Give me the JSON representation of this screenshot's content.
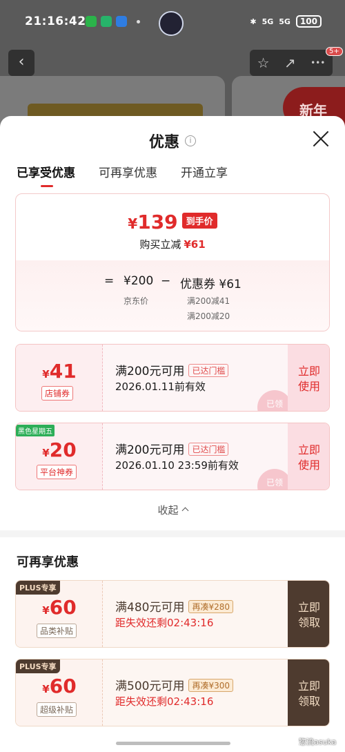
{
  "status_bar": {
    "time": "21:16:42",
    "battery": "100",
    "net1": "5G",
    "net2": "5G"
  },
  "background": {
    "back_glyph": "‹",
    "star_glyph": "☆",
    "share_glyph": "↗",
    "more_glyph": "•••",
    "badge": "5+",
    "newyear": "新年"
  },
  "sheet": {
    "title": "优惠",
    "info_glyph": "i",
    "tabs": [
      {
        "label": "已享受优惠",
        "active": true
      },
      {
        "label": "可再享优惠",
        "active": false
      },
      {
        "label": "开通立享",
        "active": false
      }
    ]
  },
  "summary": {
    "currency": "¥",
    "final_price": "139",
    "price_tag": "到手价",
    "reduce_label": "购买立减",
    "reduce_value": "¥61",
    "eq": "=",
    "base_price": "¥200",
    "base_label": "京东价",
    "minus": "−",
    "coupon_total": "优惠券 ¥61",
    "coupon_detail_1": "满200减41",
    "coupon_detail_2": "满200减20"
  },
  "coupons": [
    {
      "currency": "¥",
      "amount": "41",
      "type": "店铺券",
      "flag": "",
      "condition": "满200元可用",
      "badge": "已达门槛",
      "valid": "2026.01.11前有效",
      "stamp": "已领",
      "action_line1": "立即",
      "action_line2": "使用"
    },
    {
      "currency": "¥",
      "amount": "20",
      "type": "平台神券",
      "flag": "黑色星期五",
      "condition": "满200元可用",
      "badge": "已达门槛",
      "valid": "2026.01.10 23:59前有效",
      "stamp": "已领",
      "action_line1": "立即",
      "action_line2": "使用"
    }
  ],
  "collapse_label": "收起",
  "more_section": {
    "title": "可再享优惠",
    "items": [
      {
        "flag": "PLUS专享",
        "currency": "¥",
        "amount": "60",
        "type": "品类补贴",
        "condition": "满480元可用",
        "badge": "再凑¥280",
        "expire": "距失效还剩02:43:16",
        "action_line1": "立即",
        "action_line2": "领取"
      },
      {
        "flag": "PLUS专享",
        "currency": "¥",
        "amount": "60",
        "type": "超级补贴",
        "condition": "满500元可用",
        "badge": "再凑¥300",
        "expire": "距失效还剩02:43:16",
        "action_line1": "立即",
        "action_line2": "领取"
      }
    ]
  },
  "watermark": "惣流asuka",
  "colors": {
    "accent": "#e02b2b",
    "plus_dark": "#4e3b2f",
    "green_flag": "#2dae58"
  }
}
